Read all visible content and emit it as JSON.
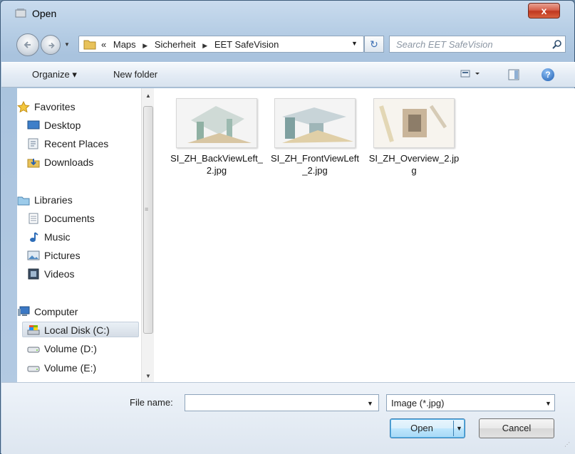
{
  "window": {
    "title": "Open",
    "close_label": "x"
  },
  "address": {
    "overflow": "«",
    "crumbs": [
      "Maps",
      "Sicherheit",
      "EET SafeVision"
    ],
    "search_placeholder": "Search EET SafeVision"
  },
  "toolbar": {
    "organize": "Organize ▾",
    "new_folder": "New folder"
  },
  "nav": {
    "favorites": "Favorites",
    "desktop": "Desktop",
    "recent": "Recent Places",
    "downloads": "Downloads",
    "libraries": "Libraries",
    "documents": "Documents",
    "music": "Music",
    "pictures": "Pictures",
    "videos": "Videos",
    "computer": "Computer",
    "local_disk": "Local Disk (C:)",
    "vol_d": "Volume (D:)",
    "vol_e": "Volume (E:)"
  },
  "files": [
    {
      "name": "SI_ZH_BackViewLeft_2.jpg"
    },
    {
      "name": "SI_ZH_FrontViewLeft_2.jpg"
    },
    {
      "name": "SI_ZH_Overview_2.jpg"
    }
  ],
  "bottom": {
    "file_name_label": "File name:",
    "file_name_value": "",
    "filter": "Image (*.jpg)",
    "open": "Open",
    "cancel": "Cancel"
  }
}
